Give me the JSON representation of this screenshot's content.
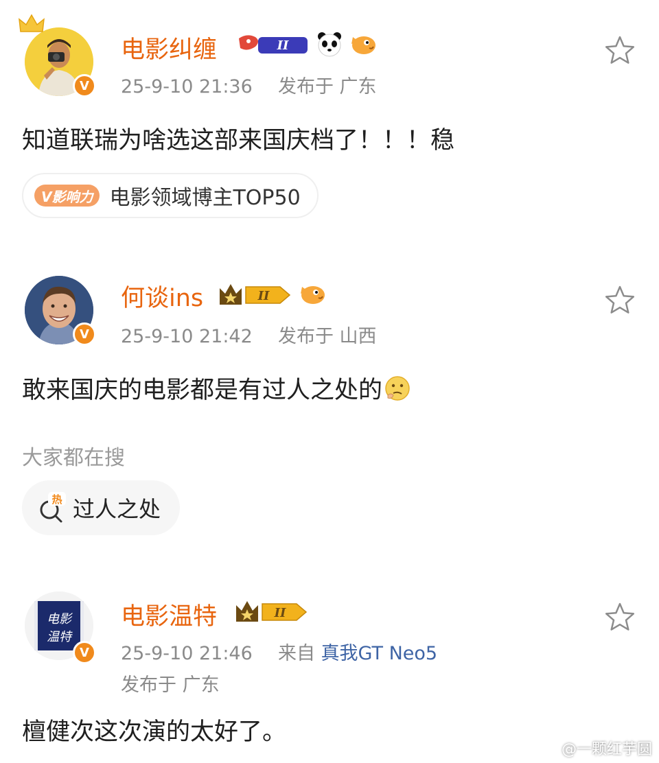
{
  "comments": [
    {
      "username": "电影纠缠",
      "level_badge": "II",
      "emoji_badges": [
        "panda-icon",
        "fish-icon"
      ],
      "verified_mark": "V",
      "timestamp": "25-9-10 21:36",
      "location_text": "发布于 广东",
      "content": "知道联瑞为啥选这部来国庆档了！！！稳",
      "influence_tag": "V影响力",
      "influence_rank": "电影领域博主TOP50",
      "avatar_icon": "photographer-avatar"
    },
    {
      "username": "何谈ins",
      "level_badge": "II",
      "emoji_badges": [
        "fish-icon"
      ],
      "verified_mark": "V",
      "timestamp": "25-9-10 21:42",
      "location_text": "发布于 山西",
      "content": "敢来国庆的电影都是有过人之处的",
      "content_emoji": "thinking-emoji",
      "search_label": "大家都在搜",
      "search_hot_tag": "热",
      "search_term": "过人之处",
      "avatar_icon": "smiling-man-avatar"
    },
    {
      "username": "电影温特",
      "level_badge": "II",
      "verified_mark": "V",
      "timestamp": "25-9-10 21:46",
      "source_prefix": "来自",
      "source_device": "真我GT Neo5",
      "location_text": "发布于 广东",
      "content": "檀健次这次演的太好了。",
      "avatar_text": "电影温特",
      "avatar_icon": "film-logo-avatar"
    }
  ],
  "watermark": "@一颗红芋圆",
  "colors": {
    "username": "#e8650f",
    "meta": "#8a8a8a",
    "verified": "#f08a1c",
    "device_link": "#3e64a5",
    "gold_badge": "#f2b21c"
  }
}
